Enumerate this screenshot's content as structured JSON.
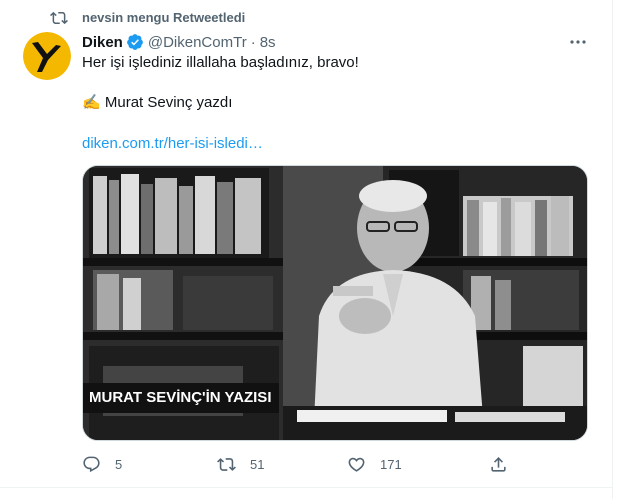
{
  "retweet": {
    "text": "nevsin mengu Retweetledi",
    "icon": "retweet-icon"
  },
  "author": {
    "name": "Diken",
    "handle": "@DikenComTr",
    "separator": "·",
    "time": "8s",
    "verified_color": "#1d9bf0"
  },
  "tweet": {
    "line1": "Her işi işlediniz illallaha başladınız, bravo!",
    "line2_emoji": "✍️",
    "line2": "Murat Sevinç yazdı",
    "link": "diken.com.tr/her-isi-isledi…"
  },
  "media": {
    "caption": "MURAT SEVİNÇ'İN YAZISI"
  },
  "actions": {
    "replies": "5",
    "retweets": "51",
    "likes": "171"
  },
  "colors": {
    "link": "#1d9bf0",
    "muted": "#536471",
    "text": "#0f1419",
    "avatar_bg": "#f5b800"
  }
}
